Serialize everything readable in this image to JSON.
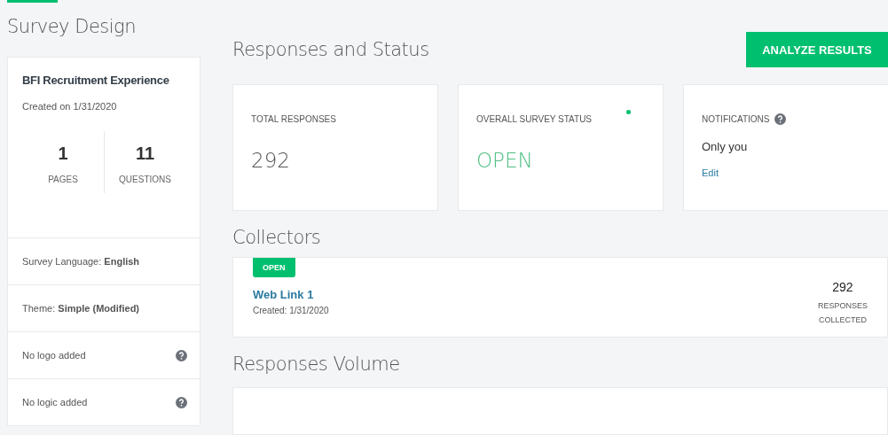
{
  "top_tab": {
    "selected": true
  },
  "survey_design": {
    "heading": "Survey Design",
    "title": "BFI Recruitment Experience",
    "created": "Created on 1/31/2020",
    "stats": [
      {
        "value": "1",
        "label": "PAGES"
      },
      {
        "value": "11",
        "label": "QUESTIONS"
      }
    ],
    "rows": [
      {
        "text": "Survey Language: **English**",
        "help": false
      },
      {
        "text": "Theme: **Simple (Modified)**",
        "help": false
      },
      {
        "text": "No logo added",
        "help": true
      },
      {
        "text": "No logic added",
        "help": true
      }
    ]
  },
  "responses_status": {
    "heading": "Responses and Status",
    "button": "ANALYZE RESULTS",
    "total": {
      "label": "TOTAL RESPONSES",
      "value": "292"
    },
    "status": {
      "label": "OVERALL SURVEY STATUS",
      "value": "OPEN"
    },
    "notifications": {
      "label": "NOTIFICATIONS",
      "value": "Only you",
      "link": "Edit"
    }
  },
  "collectors": {
    "heading": "Collectors",
    "items": [
      {
        "badge": "OPEN",
        "name": "Web Link 1",
        "created": "Created: 1/31/2020",
        "count": "292",
        "count_label_1": "RESPONSES",
        "count_label_2": "COLLECTED"
      }
    ]
  },
  "responses_volume": {
    "heading": "Responses Volume"
  }
}
